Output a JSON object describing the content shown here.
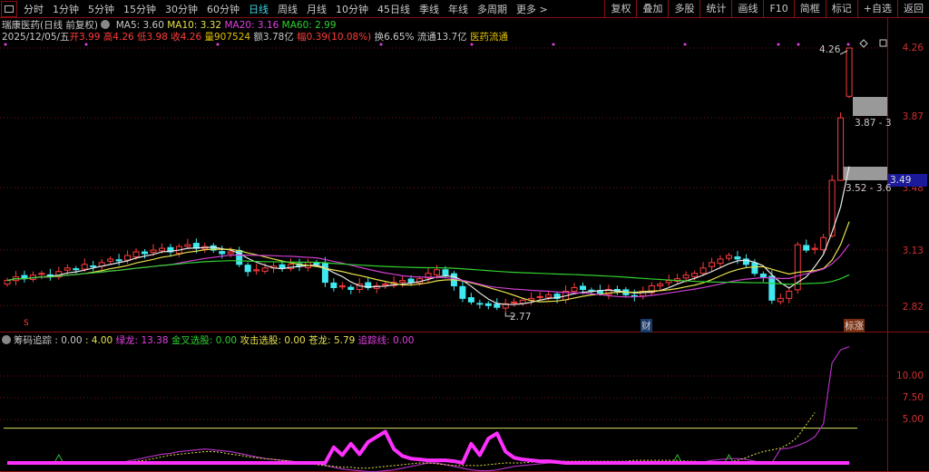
{
  "toolbar": {
    "periods": [
      "分时",
      "1分钟",
      "5分钟",
      "15分钟",
      "30分钟",
      "60分钟",
      "日线",
      "周线",
      "月线",
      "10分钟",
      "45日线",
      "季线",
      "年线",
      "多周期",
      "更多 >"
    ],
    "active_period": "日线",
    "right_buttons": [
      "复权",
      "叠加",
      "多股",
      "统计",
      "画线",
      "F10",
      "简框",
      "标记",
      "+自选",
      "返回"
    ]
  },
  "header": {
    "title": "瑞康医药(日线 前复权)",
    "ma5": "MA5: 3.60",
    "ma10": "MA10: 3.32",
    "ma20": "MA20: 3.16",
    "ma60": "MA60: 2.99",
    "date": "2025/12/05/五",
    "open": "开3.99",
    "high": "高4.26",
    "low": "低3.98",
    "close": "收4.26",
    "volume": "量907524",
    "amount": "额3.78亿",
    "change": "幅0.39(10.08%)",
    "turnover": "换6.65%",
    "float": "流通13.7亿",
    "sector": "医药流通"
  },
  "price_axis": {
    "labels": [
      "4.26",
      "3.87",
      "3.48",
      "3.13",
      "2.82"
    ],
    "current": "3.49"
  },
  "annotations": {
    "high_label": "4.26",
    "low_label": "2.77",
    "zone1": "3.87 - 3",
    "zone2": "3.52 - 3.6",
    "s_mark": "S",
    "fin_mark": "财",
    "limit_mark": "标涨"
  },
  "colors": {
    "up": "#ff3c3c",
    "down": "#40e8f0",
    "ma5": "#e8e8e8",
    "ma10": "#e6e04a",
    "ma20": "#d040d0",
    "ma60": "#30d030",
    "grid": "#8a1010"
  },
  "candles": {
    "closes": [
      2.96,
      2.98,
      2.97,
      2.99,
      3.0,
      2.98,
      3.01,
      3.03,
      3.02,
      3.05,
      3.04,
      3.06,
      3.08,
      3.07,
      3.1,
      3.12,
      3.11,
      3.13,
      3.14,
      3.12,
      3.15,
      3.16,
      3.14,
      3.15,
      3.13,
      3.11,
      3.12,
      3.05,
      3.01,
      3.02,
      3.03,
      3.04,
      3.03,
      3.05,
      3.04,
      3.06,
      3.05,
      2.95,
      2.92,
      2.93,
      2.91,
      2.94,
      2.92,
      2.93,
      2.94,
      2.95,
      2.96,
      2.95,
      2.97,
      3.0,
      3.02,
      2.99,
      2.93,
      2.86,
      2.84,
      2.83,
      2.82,
      2.81,
      2.83,
      2.84,
      2.85,
      2.86,
      2.87,
      2.88,
      2.86,
      2.9,
      2.92,
      2.91,
      2.9,
      2.89,
      2.91,
      2.9,
      2.88,
      2.87,
      2.9,
      2.93,
      2.94,
      2.96,
      2.97,
      2.99,
      3.0,
      3.03,
      3.06,
      3.08,
      3.1,
      3.08,
      3.05,
      3.0,
      2.98,
      2.85,
      2.86,
      2.9,
      3.16,
      3.13,
      3.14,
      3.2,
      3.52,
      3.87,
      4.26
    ],
    "last_ohlc": [
      3.99,
      4.26,
      3.98,
      4.26
    ]
  },
  "indicator": {
    "name": "筹码追踪",
    "v1": ": 0.00",
    "v2": ": 4.00",
    "green_dragon": "绿龙: 13.38",
    "golden_cross": "金叉选股: 0.00",
    "attack": "攻击选股: 0.00",
    "blue_dragon": "苍龙: 5.79",
    "track_line": "追踪线: 0.00",
    "axis_labels": [
      "10.00",
      "7.50",
      "5.00"
    ],
    "threshold": 4.0,
    "tracking": [
      0,
      0,
      0,
      0,
      0,
      0,
      0,
      0,
      0,
      0,
      0,
      0,
      0,
      0,
      0,
      0,
      0,
      0,
      0,
      0,
      0,
      0,
      0,
      0,
      0,
      0,
      0,
      0,
      0,
      0,
      0,
      0,
      0,
      0,
      0,
      0,
      0,
      0,
      1.8,
      0.9,
      2.2,
      1.0,
      2.4,
      3.0,
      3.6,
      1.6,
      0.8,
      0.5,
      0.4,
      0.3,
      0.3,
      0.3,
      0.2,
      0,
      2.2,
      0.9,
      2.8,
      3.4,
      1.3,
      0.6,
      0.4,
      0.3,
      0.2,
      0.2,
      0.1,
      0,
      0,
      0,
      0,
      0,
      0,
      0,
      0,
      0,
      0,
      0,
      0,
      0,
      0,
      0,
      0,
      0,
      0,
      0,
      0,
      0,
      0,
      0,
      0,
      0,
      0,
      0,
      0,
      0,
      0,
      0,
      0,
      0,
      0
    ],
    "green_line": [
      0,
      0,
      0,
      0,
      0,
      0,
      0,
      0,
      0,
      0,
      0,
      0,
      0,
      0,
      0.2,
      0.4,
      0.6,
      0.8,
      1.0,
      1.1,
      1.3,
      1.4,
      1.5,
      1.6,
      1.5,
      1.4,
      1.3,
      1.1,
      0.9,
      0.7,
      0.5,
      0.4,
      0.3,
      0.2,
      0.1,
      0,
      0,
      -0.3,
      -0.5,
      -0.7,
      -0.8,
      -0.9,
      -1.0,
      -1.0,
      -0.9,
      -0.8,
      -0.6,
      -0.4,
      -0.2,
      0,
      0,
      -0.2,
      -0.4,
      -0.6,
      -0.8,
      -0.9,
      -0.9,
      -0.8,
      -0.6,
      -0.4,
      -0.3,
      -0.2,
      -0.1,
      0,
      0,
      0,
      0,
      0,
      0,
      0,
      0,
      0,
      0,
      0,
      0,
      0,
      0,
      0,
      0,
      0,
      0,
      0.1,
      0.3,
      0.4,
      0.5,
      0.5,
      0.4,
      0.2,
      0,
      0,
      1.6,
      1.7,
      2.0,
      2.4,
      3.0,
      4.5,
      11.5,
      13.0,
      13.38
    ],
    "blue_line": [
      0,
      0,
      0,
      0,
      0,
      0,
      0,
      0,
      0,
      0,
      0,
      0,
      0,
      0,
      0.1,
      0.2,
      0.3,
      0.5,
      0.7,
      0.9,
      1.0,
      1.1,
      1.2,
      1.3,
      1.3,
      1.2,
      1.0,
      0.9,
      0.7,
      0.6,
      0.5,
      0.4,
      0.3,
      0.2,
      0.1,
      0,
      -0.2,
      -0.3,
      -0.4,
      -0.5,
      -0.5,
      -0.6,
      -0.6,
      -0.5,
      -0.4,
      -0.3,
      -0.2,
      -0.1,
      0,
      0,
      -0.1,
      -0.2,
      -0.3,
      -0.3,
      -0.3,
      -0.3,
      -0.2,
      -0.1,
      0,
      0,
      0,
      0.1,
      0.1,
      0.1,
      0.2,
      0.2,
      0.2,
      0.2,
      0.2,
      0.2,
      0.2,
      0.2,
      0.2,
      0.3,
      0.3,
      0.3,
      0.3,
      0.3,
      0.3,
      0.2,
      0.2,
      0.1,
      0,
      0,
      0.1,
      0.3,
      0.6,
      1.0,
      1.3,
      1.5,
      1.7,
      2.2,
      3.0,
      4.4,
      5.79
    ]
  }
}
